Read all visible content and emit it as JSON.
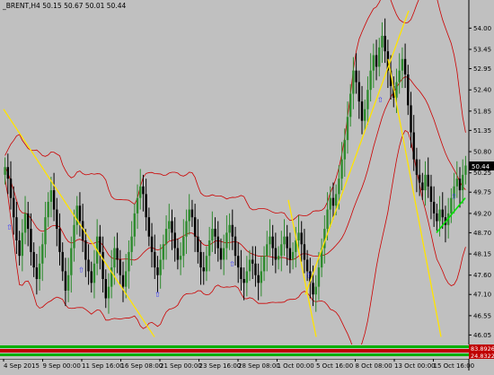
{
  "window": {
    "title_line": "_BRENT,H4  50.15 50.67 50.01 50.44"
  },
  "colors": {
    "background": "#c0c0c0",
    "bull_candle": "#2e8b2e",
    "bear_candle": "#000000",
    "bands": "#cc0000",
    "trendline": "#ffe400",
    "signal_line": "#00e000",
    "arrow_marker": "#3333ff",
    "price_tag_bg": "#000000",
    "price_tag_fg": "#ffffff",
    "subwindow_green": "#00b000",
    "subwindow_red": "#c00000"
  },
  "chart_data": {
    "type": "candlestick",
    "symbol": "_BRENT",
    "timeframe": "H4",
    "ohlc_header": {
      "open": 50.15,
      "high": 50.67,
      "low": 50.01,
      "close": 50.44
    },
    "current_price": "50.44",
    "y_axis": {
      "ticks": [
        "54.00",
        "53.45",
        "52.95",
        "52.40",
        "51.85",
        "51.35",
        "50.80",
        "50.25",
        "49.75",
        "49.20",
        "48.70",
        "48.15",
        "47.60",
        "47.10",
        "46.55",
        "46.05"
      ],
      "ylim": [
        45.85,
        54.45
      ]
    },
    "x_axis": {
      "ticks": [
        "4 Sep 2015",
        "9 Sep 00:00",
        "11 Sep 16:00",
        "16 Sep 08:00",
        "21 Sep 00:00",
        "23 Sep 16:00",
        "28 Sep 08:00",
        "1 Oct 00:00",
        "5 Oct 16:00",
        "8 Oct 08:00",
        "13 Oct 00:00",
        "15 Oct 16:00"
      ]
    },
    "series_close": [
      50.4,
      50.1,
      49.6,
      49.1,
      48.5,
      48.1,
      48.7,
      49.2,
      48.8,
      48.2,
      47.8,
      47.5,
      47.9,
      48.4,
      49.1,
      49.5,
      49.8,
      49.3,
      48.8,
      48.2,
      47.7,
      47.2,
      47.6,
      48.3,
      48.9,
      49.4,
      49.0,
      48.5,
      48.0,
      47.7,
      47.4,
      47.9,
      48.6,
      48.2,
      47.5,
      47.0,
      47.3,
      47.8,
      48.3,
      48.0,
      47.6,
      47.3,
      47.7,
      48.2,
      48.6,
      49.2,
      49.6,
      49.9,
      49.7,
      49.1,
      48.6,
      48.2,
      47.8,
      47.6,
      48.0,
      48.4,
      48.8,
      49.0,
      48.7,
      48.3,
      48.0,
      48.1,
      48.6,
      49.0,
      49.3,
      49.1,
      48.6,
      48.2,
      47.8,
      47.7,
      48.1,
      48.5,
      48.8,
      48.6,
      48.3,
      48.0,
      48.3,
      48.7,
      48.9,
      48.6,
      48.1,
      47.8,
      47.5,
      47.4,
      47.7,
      48.0,
      47.9,
      47.6,
      47.4,
      47.7,
      48.1,
      48.4,
      48.6,
      48.3,
      48.0,
      48.1,
      48.4,
      48.6,
      48.3,
      48.0,
      48.2,
      48.5,
      48.7,
      48.4,
      48.0,
      47.7,
      47.4,
      47.1,
      47.3,
      47.8,
      48.3,
      48.8,
      49.3,
      49.6,
      49.4,
      49.7,
      50.1,
      50.6,
      51.1,
      51.7,
      52.3,
      52.9,
      52.6,
      52.1,
      51.6,
      51.9,
      52.4,
      52.9,
      53.3,
      53.0,
      53.5,
      53.8,
      53.4,
      52.9,
      52.5,
      52.2,
      52.6,
      52.9,
      53.2,
      52.8,
      52.0,
      51.3,
      50.6,
      50.2,
      50.0,
      49.8,
      50.2,
      49.9,
      49.5,
      49.2,
      49.0,
      49.3,
      49.1,
      48.9,
      49.2,
      49.6,
      49.9,
      50.1,
      49.8,
      50.2,
      50.44
    ],
    "annotations": [
      "yellow trendlines",
      "red envelope bands",
      "green signal line",
      "arrow markers"
    ]
  },
  "subwindow": {
    "upper_value": "83.8926",
    "lower_value": "24.8322"
  }
}
